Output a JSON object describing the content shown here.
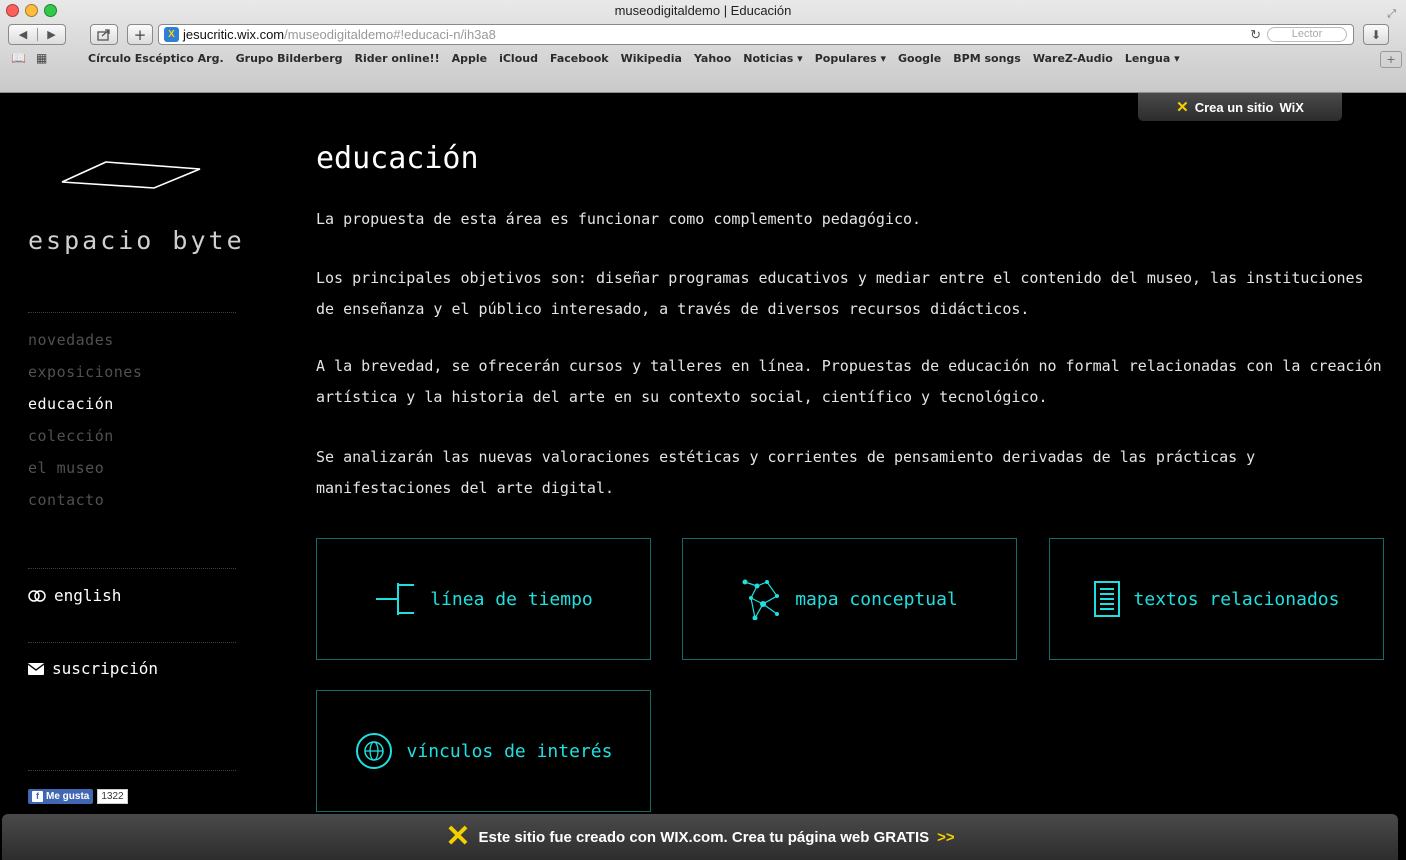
{
  "browser": {
    "title": "museodigitaldemo | Educación",
    "url_domain": "jesucritic.wix.com",
    "url_path": "/museodigitaldemo#!educaci-n/ih3a8",
    "reader_label": "Lector",
    "bookmarks": [
      "Círculo Escéptico Arg.",
      "Grupo Bilderberg",
      "Rider online!!",
      "Apple",
      "iCloud",
      "Facebook",
      "Wikipedia",
      "Yahoo",
      "Noticias ▾",
      "Populares ▾",
      "Google",
      "BPM songs",
      "WareZ-Audio",
      "Lengua ▾"
    ]
  },
  "wix_badge": {
    "text": "Crea un sitio",
    "brand": "WiX"
  },
  "sidebar": {
    "brand": "espacio byte",
    "nav": [
      {
        "label": "novedades",
        "active": false
      },
      {
        "label": "exposiciones",
        "active": false
      },
      {
        "label": "educación",
        "active": true
      },
      {
        "label": "colección",
        "active": false
      },
      {
        "label": "el museo",
        "active": false
      },
      {
        "label": "contacto",
        "active": false
      }
    ],
    "english_label": "english",
    "subscribe_label": "suscripción",
    "like_label": "Me gusta",
    "like_count": "1322"
  },
  "main": {
    "title": "educación",
    "paragraphs": [
      "La propuesta de esta área es funcionar como complemento pedagógico.",
      "Los principales objetivos son: diseñar programas educativos y mediar entre el contenido del museo, las instituciones de enseñanza y el público interesado, a través de diversos recursos didácticos.",
      "A la brevedad, se ofrecerán cursos y talleres en línea. Propuestas de educación no formal relacionadas con la creación artística y la historia del arte en su contexto social, científico y tecnológico.",
      "Se analizarán las nuevas valoraciones estéticas y corrientes de pensamiento derivadas de las prácticas y manifestaciones del arte digital."
    ],
    "tiles": [
      {
        "label": "línea de tiempo",
        "icon": "timeline-icon"
      },
      {
        "label": "mapa conceptual",
        "icon": "network-icon"
      },
      {
        "label": "textos relacionados",
        "icon": "document-icon"
      },
      {
        "label": "vínculos de interés",
        "icon": "globe-icon"
      }
    ],
    "accent_color": "#1fe0e0"
  },
  "banner": {
    "text": "Este sitio fue creado con WIX.com. Crea tu página web GRATIS",
    "arrow": ">>"
  }
}
